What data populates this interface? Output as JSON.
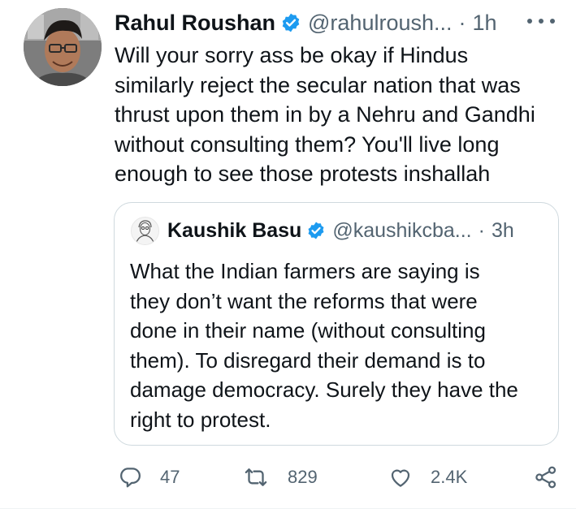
{
  "tweet": {
    "author_name": "Rahul Roushan",
    "author_handle": "@rahulroush...",
    "separator": "·",
    "time": "1h",
    "text_lines": [
      "Will your sorry ass be okay if Hindus",
      "similarly reject the secular nation that was",
      "thrust upon them in by a Nehru and Gandhi",
      "without consulting them? You'll live long",
      "enough to see those protests inshallah"
    ]
  },
  "quoted": {
    "author_name": "Kaushik Basu",
    "author_handle": "@kaushikcba...",
    "separator": "·",
    "time": "3h",
    "text_lines": [
      "What the Indian farmers are saying is",
      "they don’t want the reforms that were",
      "done in their name (without consulting",
      "them). To disregard their demand is to",
      "damage democracy. Surely they have the",
      "right to protest."
    ]
  },
  "actions": {
    "reply_count": "47",
    "retweet_count": "829",
    "like_count": "2.4K"
  },
  "colors": {
    "verified": "#1d9bf0",
    "muted": "#536471",
    "border": "#cfd9de"
  }
}
